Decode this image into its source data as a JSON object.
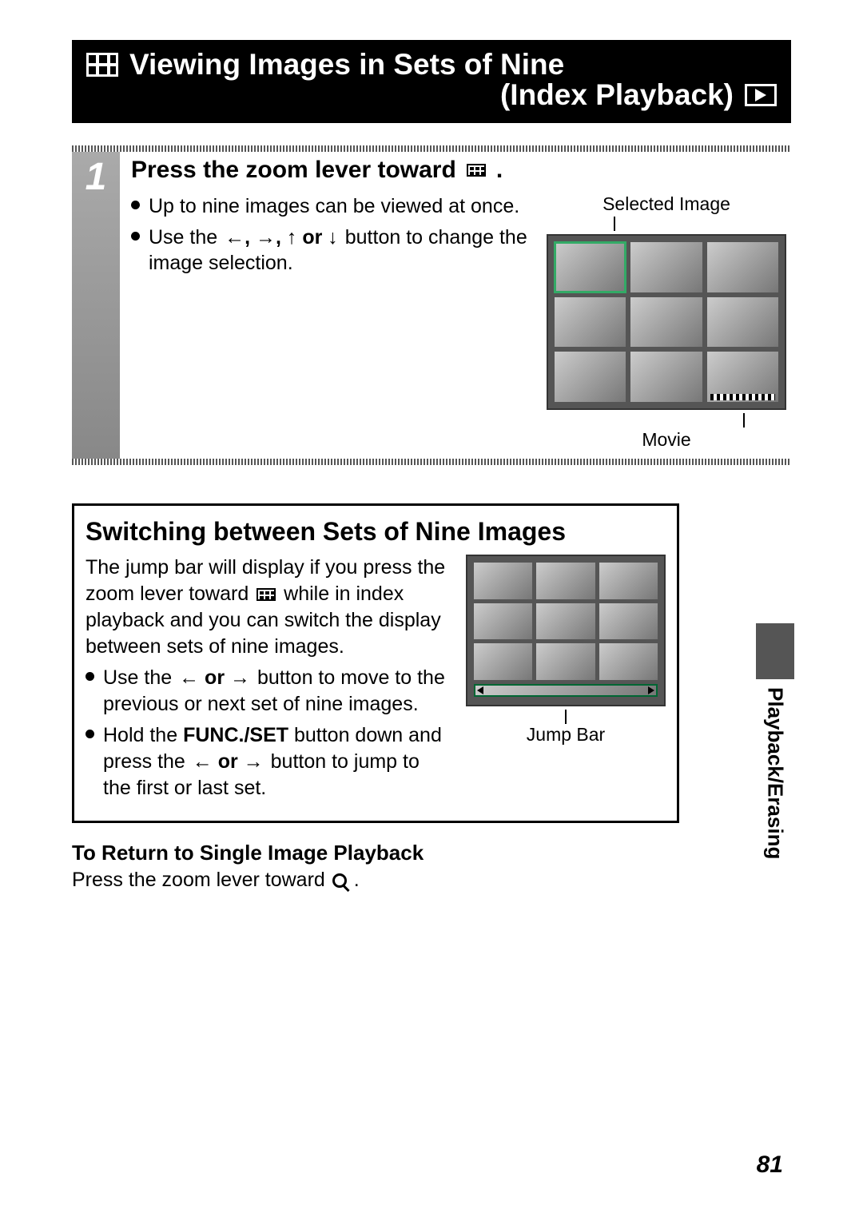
{
  "title": {
    "line1": "Viewing Images in Sets of Nine",
    "line2": "(Index Playback)"
  },
  "step1": {
    "number": "1",
    "heading_pre": "Press the zoom lever toward",
    "heading_post": ".",
    "bullet1": "Up to nine images can be viewed at once.",
    "bullet2_pre": "Use the ",
    "bullet2_arrows": "←,  →,  ↑  or  ↓",
    "bullet2_post": " button to change the image selection.",
    "fig_top": "Selected Image",
    "fig_bottom": "Movie"
  },
  "switching": {
    "title": "Switching between Sets of Nine Images",
    "para_pre": "The jump bar will display if you press the zoom lever toward ",
    "para_post": " while in index playback and you can switch the display between sets of nine images.",
    "bullet1_pre": "Use the ",
    "bullet1_arrows": "←  or  →",
    "bullet1_post": " button to move to the previous or next set of nine images.",
    "bullet2_pre": "Hold the ",
    "bullet2_bold": "FUNC./SET",
    "bullet2_mid": " button down and press the ",
    "bullet2_arrows": "←  or  →",
    "bullet2_post": " button to jump to the first or last set.",
    "fig_label": "Jump Bar"
  },
  "return": {
    "heading": "To Return to Single Image Playback",
    "text_pre": "Press the zoom lever toward ",
    "text_post": "."
  },
  "side_tab": "Playback/Erasing",
  "page_number": "81"
}
